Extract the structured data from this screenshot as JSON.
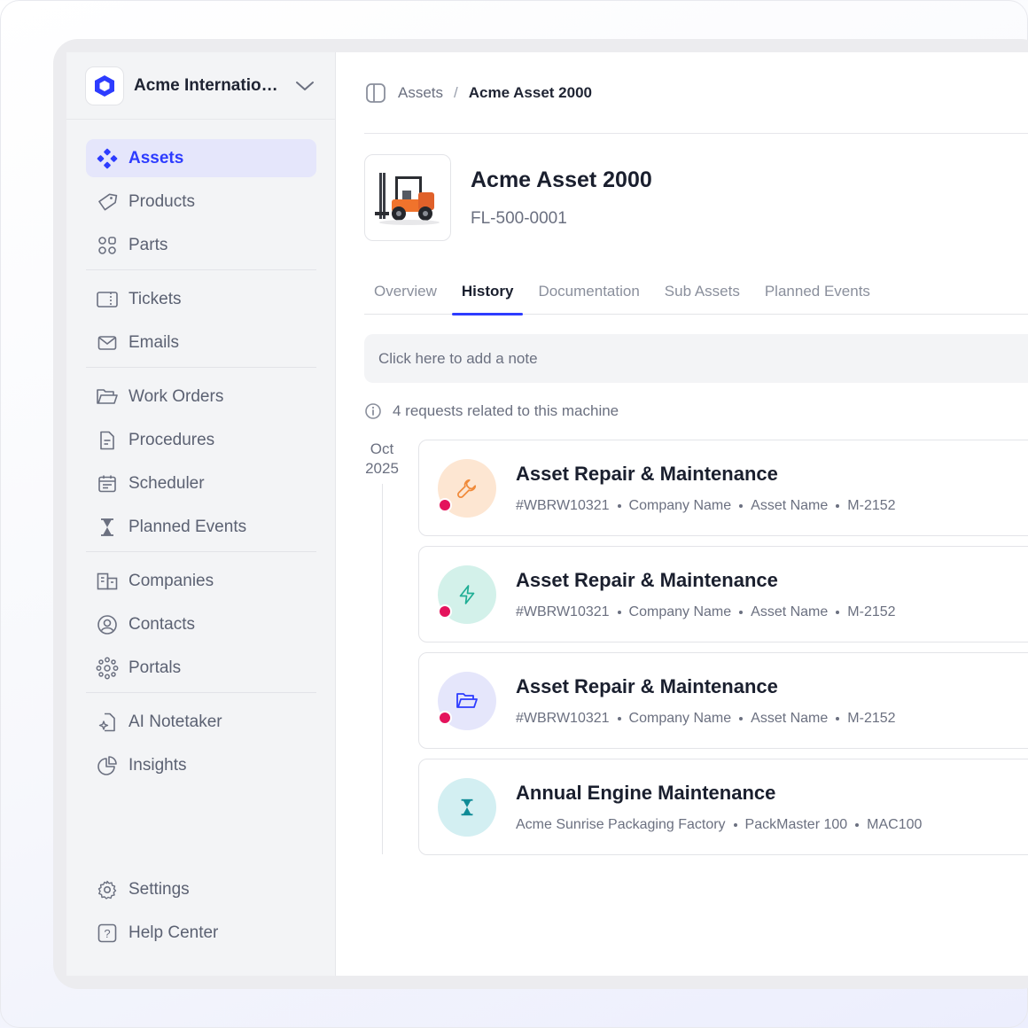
{
  "org": {
    "name": "Acme International Holdings"
  },
  "sidebar": {
    "groups": [
      [
        {
          "label": "Assets",
          "icon": "assets-icon",
          "active": true
        },
        {
          "label": "Products",
          "icon": "tag-icon"
        },
        {
          "label": "Parts",
          "icon": "parts-icon"
        }
      ],
      [
        {
          "label": "Tickets",
          "icon": "ticket-icon"
        },
        {
          "label": "Emails",
          "icon": "mail-icon"
        }
      ],
      [
        {
          "label": "Work Orders",
          "icon": "folder-icon"
        },
        {
          "label": "Procedures",
          "icon": "document-icon"
        },
        {
          "label": "Scheduler",
          "icon": "calendar-icon"
        },
        {
          "label": "Planned Events",
          "icon": "hourglass-icon"
        }
      ],
      [
        {
          "label": "Companies",
          "icon": "building-icon"
        },
        {
          "label": "Contacts",
          "icon": "user-circle-icon"
        },
        {
          "label": "Portals",
          "icon": "portals-icon"
        }
      ],
      [
        {
          "label": "AI Notetaker",
          "icon": "ai-note-icon"
        },
        {
          "label": "Insights",
          "icon": "pie-chart-icon"
        }
      ]
    ],
    "bottom": [
      {
        "label": "Settings",
        "icon": "gear-icon"
      },
      {
        "label": "Help Center",
        "icon": "help-icon"
      }
    ]
  },
  "breadcrumb": {
    "parent": "Assets",
    "separator": "/",
    "current": "Acme Asset 2000"
  },
  "asset": {
    "title": "Acme Asset 2000",
    "code": "FL-500-0001"
  },
  "tabs": [
    "Overview",
    "History",
    "Documentation",
    "Sub Assets",
    "Planned Events"
  ],
  "active_tab": "History",
  "note": {
    "placeholder": "Click here to add a note"
  },
  "requests_info": "4 requests related to this machine",
  "timeline": {
    "month": "Oct",
    "year": "2025",
    "items": [
      {
        "title": "Asset Repair & Maintenance",
        "meta": [
          "#WBRW10321",
          "Company Name",
          "Asset Name",
          "M-2152"
        ],
        "icon": "wrench-icon",
        "bg": "#fde6d2",
        "fg": "#f08a3a",
        "dot": true
      },
      {
        "title": "Asset Repair & Maintenance",
        "meta": [
          "#WBRW10321",
          "Company Name",
          "Asset Name",
          "M-2152"
        ],
        "icon": "lightning-icon",
        "bg": "#d3f1ea",
        "fg": "#1fae95",
        "dot": true
      },
      {
        "title": "Asset Repair & Maintenance",
        "meta": [
          "#WBRW10321",
          "Company Name",
          "Asset Name",
          "M-2152"
        ],
        "icon": "folder-open-icon",
        "bg": "#e5e6fb",
        "fg": "#2d3cff",
        "dot": true
      },
      {
        "title": "Annual Engine Maintenance",
        "meta": [
          "Acme Sunrise Packaging Factory",
          "PackMaster 100",
          "MAC100"
        ],
        "icon": "hourglass-icon",
        "bg": "#d3eff2",
        "fg": "#0f8b96",
        "dot": false
      }
    ]
  },
  "colors": {
    "accent": "#2d3cff",
    "alert_dot": "#e4135c"
  }
}
